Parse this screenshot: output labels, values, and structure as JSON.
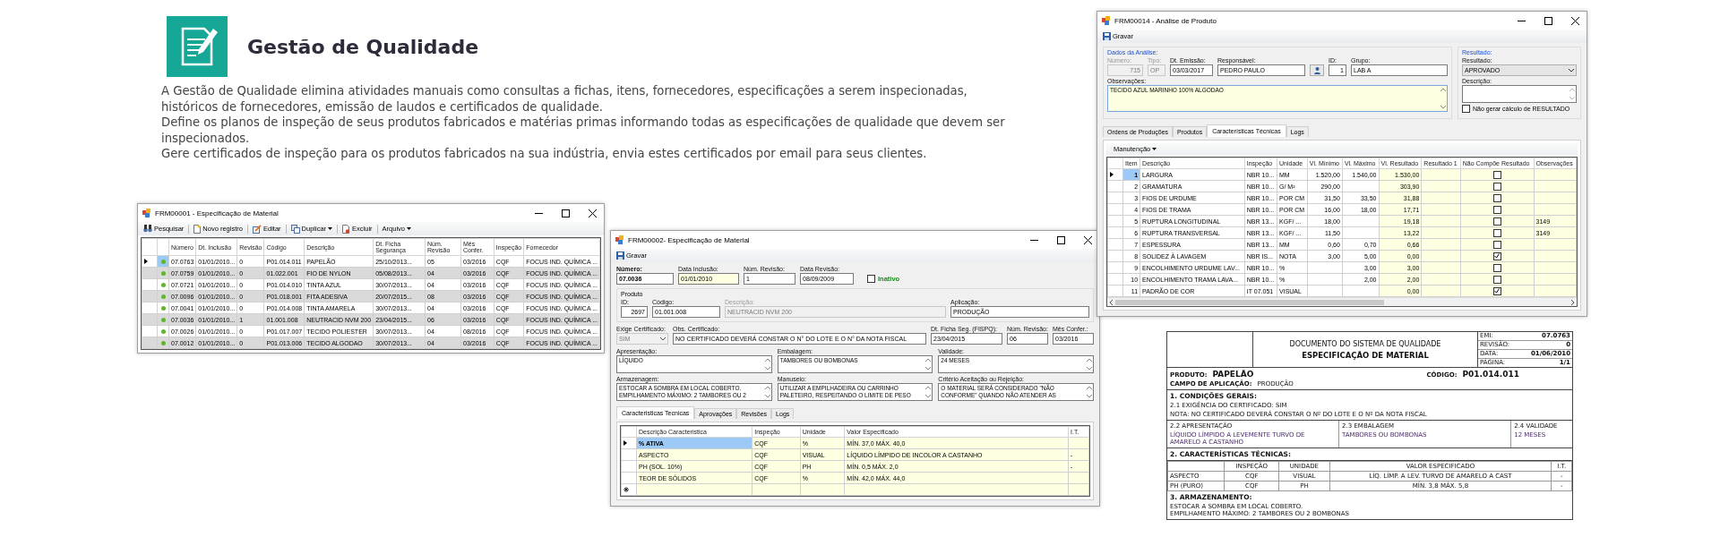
{
  "header": {
    "title": "Gestão de Qualidade",
    "paragraphs": [
      "A Gestão de Qualidade elimina atividades manuais como consultas a fichas, itens, fornecedores, especificações a serem inspecionadas, históricos de fornecedores, emissão de laudos e certificados de qualidade.",
      "Define os planos de inspeção de seus produtos fabricados e matérias primas informando todas as especificações de qualidade que devem ser inspecionados.",
      "Gere certificados de inspeção para os produtos fabricados na sua indústria, envia estes certificados por email para seus clientes."
    ]
  },
  "list_window": {
    "title": "FRM00001 - Especificação de Material",
    "toolbar": {
      "search": "Pesquisar",
      "new": "Novo registro",
      "edit": "Editar",
      "duplicate": "Duplicar",
      "delete": "Excluir",
      "file": "Arquivo"
    },
    "columns": [
      "Número",
      "Dt. Inclusão",
      "Revisão",
      "Código",
      "Descrição",
      "Dt. Ficha Segurança",
      "Núm. Revisão",
      "Mês Confer.",
      "Inspeção",
      "Fornecedor"
    ],
    "rows": [
      {
        "selected": true,
        "cells": [
          "07.0763",
          "01/01/2010...",
          "0",
          "P01.014.011",
          "PAPELÃO",
          "25/10/2013...",
          "05",
          "03/2016",
          "CQF",
          "FOCUS IND. QUÍMICA ..."
        ]
      },
      {
        "selected": false,
        "cells": [
          "07.0759",
          "01/01/2010...",
          "0",
          "01.022.001",
          "FIO DE NYLON",
          "05/08/2013...",
          "04",
          "03/2016",
          "CQF",
          "FOCUS IND. QUÍMICA ..."
        ]
      },
      {
        "selected": false,
        "cells": [
          "07.0721",
          "01/01/2010...",
          "0",
          "P01.014.010",
          "TINTA AZUL",
          "30/07/2013...",
          "04",
          "03/2016",
          "CQF",
          "FOCUS IND. QUÍMICA ..."
        ]
      },
      {
        "selected": false,
        "cells": [
          "07.0096",
          "01/01/2010...",
          "0",
          "P01.018.001",
          "FITA ADESIVA",
          "20/07/2015...",
          "08",
          "03/2016",
          "CQF",
          "FOCUS IND. QUÍMICA ..."
        ]
      },
      {
        "selected": false,
        "cells": [
          "07.0041",
          "01/01/2010...",
          "0",
          "P01.014.008",
          "TINTA AMARELA",
          "30/07/2013...",
          "04",
          "03/2016",
          "CQF",
          "FOCUS IND. QUÍMICA ..."
        ]
      },
      {
        "selected": false,
        "cells": [
          "07.0036",
          "01/01/2010...",
          "1",
          "01.001.008",
          "NEUTRACID NVM 200",
          "23/04/2015...",
          "06",
          "03/2016",
          "CQF",
          "FOCUS IND. QUÍMICA ..."
        ]
      },
      {
        "selected": false,
        "cells": [
          "07.0026",
          "01/01/2010...",
          "0",
          "P01.017.007",
          "TECIDO POLIESTER",
          "30/07/2013...",
          "04",
          "08/2016",
          "CQF",
          "FOCUS IND. QUÍMICA ..."
        ]
      },
      {
        "selected": false,
        "cells": [
          "07.0012",
          "01/01/2010...",
          "0",
          "P01.013.006",
          "TECIDO ALGODAO",
          "30/07/2013...",
          "04",
          "03/2016",
          "CQF",
          "FOCUS IND. QUÍMICA ..."
        ]
      }
    ]
  },
  "form_window": {
    "title": "FRM00002- Especificação de Material",
    "save": "Gravar",
    "numero": {
      "label": "Número:",
      "value": "07.0036"
    },
    "data_inclusao": {
      "label": "Data Inclusão:",
      "value": "01/01/2010"
    },
    "num_revisao": {
      "label": "Núm. Revisão:",
      "value": "1"
    },
    "data_revisao": {
      "label": "Data Revisão:",
      "value": "08/09/2009"
    },
    "inativo": {
      "label": "Inativo",
      "checked": false
    },
    "produto": {
      "label": "Produto",
      "id": {
        "label": "ID:",
        "value": "2697"
      },
      "codigo": {
        "label": "Código:",
        "value": "01.001.008"
      },
      "descricao": {
        "label": "Descrição:",
        "value": "NEUTRACID NVM 200",
        "disabled": true
      },
      "aplicacao": {
        "label": "Aplicação:",
        "value": "PRODUÇÃO"
      }
    },
    "exige_certificado": {
      "label": "Exige Certificado:",
      "value": "SIM",
      "disabled": true
    },
    "obs_certificado": {
      "label": "Obs. Certificado:",
      "value": "NO CERTIFICADO DEVERÁ CONSTAR O N° DO LOTE E O N° DA NOTA FISCAL"
    },
    "dt_ficha": {
      "label": "Dt. Ficha Seg. (FISPQ):",
      "value": "23/04/2015"
    },
    "num_revisao_ficha": {
      "label": "Núm. Revisão:",
      "value": "06"
    },
    "mes_confer": {
      "label": "Mês Confer.:",
      "value": "03/2016"
    },
    "memos": [
      {
        "label": "Apresentação:",
        "value": "LÍQUIDO"
      },
      {
        "label": "Embalagem:",
        "value": "TAMBORES OU BOMBONAS"
      },
      {
        "label": "Validade:",
        "value": "24 MESES"
      },
      {
        "label": "Armazenagem:",
        "value": "ESTOCAR A SOMBRA EM LOCAL COBERTO.\nEMPILHAMENTO MÁXIMO: 2 TAMBORES OU 2"
      },
      {
        "label": "Manuseio:",
        "value": "UTILIZAR A EMPILHADEIRA OU CARRINHO\nPALETEIRO, RESPEITANDO O LIMITE DE PESO"
      },
      {
        "label": "Critério Aceitação ou Rejeição:",
        "value": "O MATERIAL SERÁ CONSIDERADO \"NÃO\nCONFORME\" QUANDO NÃO ATENDER AS"
      }
    ],
    "tabs": [
      {
        "label": "Caracteristicas Tecnicas",
        "selected": true
      },
      {
        "label": "Aprovações",
        "selected": false
      },
      {
        "label": "Revisões",
        "selected": false
      },
      {
        "label": "Logs",
        "selected": false
      }
    ],
    "grid": {
      "columns": [
        "Descrição Caracteristica",
        "Inspeção",
        "Unidade",
        "Valor Especificado",
        "I.T."
      ],
      "rows": [
        {
          "selected": true,
          "cells": [
            "% ATIVA",
            "CQF",
            "%",
            "MÍN. 37,0 MÁX. 40,0"
          ]
        },
        {
          "selected": false,
          "cells": [
            "ASPECTO",
            "CQF",
            "VISUAL",
            "LÍQUIDO LÍMPIDO DE INCOLOR A CASTANHO",
            "-"
          ]
        },
        {
          "selected": false,
          "cells": [
            "PH (SOL. 10%)",
            "CQF",
            "PH",
            "MÍN. 0,5 MÁX. 2,0",
            "-"
          ]
        },
        {
          "selected": false,
          "cells": [
            "TEOR DE SÓLIDOS",
            "CQF",
            "%",
            "MÍN. 42,0 MÁX. 44,0"
          ]
        }
      ]
    }
  },
  "analysis_window": {
    "title": "FRM00014 - Análise de Produto",
    "save": "Gravar",
    "data_group": "Dados da Análise:",
    "numero": {
      "label": "Número:",
      "value": "715",
      "disabled": true
    },
    "tipo": {
      "label": "Tipo:",
      "value": "OP",
      "disabled": true
    },
    "dt_emissao": {
      "label": "Dt. Emissão:",
      "value": "03/03/2017"
    },
    "responsavel": {
      "label": "Responsável:",
      "value": "PEDRO PAULO"
    },
    "id": {
      "label": "ID:",
      "value": "1"
    },
    "grupo": {
      "label": "Grupo:",
      "value": "LAB A"
    },
    "observacoes": {
      "label": "Observações:",
      "value": "TECIDO AZUL MARINHO 100% ALGODAO"
    },
    "result_group": "Resultado:",
    "resultado": {
      "label": "Resultado:",
      "value": "APROVADO"
    },
    "descricao": {
      "label": "Descrição:"
    },
    "no_calc": {
      "label": "Não gerar cálculo de RESULTADO",
      "checked": false
    },
    "tabs": [
      {
        "label": "Ordens de Produções",
        "selected": false
      },
      {
        "label": "Produtos",
        "selected": false
      },
      {
        "label": "Características Técnicas",
        "selected": true
      },
      {
        "label": "Logs",
        "selected": false
      }
    ],
    "menu": "Manutenção",
    "columns": [
      "Item",
      "Descrição",
      "Inspeção",
      "Unidade",
      "Vl. Mínimo",
      "Vl. Máximo",
      "Vl. Resultado",
      "Resultado 1",
      "Não Compõe Resultado",
      "Observações"
    ],
    "rows": [
      {
        "selected": true,
        "item": "1",
        "descricao": "LARGURA",
        "inspecao": "NBR 10...",
        "unidade": "MM",
        "minimo": "1.520,00",
        "maximo": "1.540,00",
        "resultado": "1.530,00",
        "nao_compoe": false
      },
      {
        "selected": false,
        "item": "2",
        "descricao": "GRAMATURA",
        "inspecao": "NBR 10...",
        "unidade": "G/ M²",
        "minimo": "290,00",
        "resultado": "303,90",
        "nao_compoe": false
      },
      {
        "selected": false,
        "item": "3",
        "descricao": "FIOS DE URDUME",
        "inspecao": "NBR 10...",
        "unidade": "POR CM",
        "minimo": "31,50",
        "maximo": "33,50",
        "resultado": "31,88",
        "nao_compoe": false
      },
      {
        "selected": false,
        "item": "4",
        "descricao": "FIOS DE TRAMA",
        "inspecao": "NBR 10...",
        "unidade": "POR CM",
        "minimo": "16,00",
        "maximo": "18,00",
        "resultado": "17,71",
        "nao_compoe": false
      },
      {
        "selected": false,
        "item": "5",
        "descricao": "RUPTURA LONGITUDINAL",
        "inspecao": "NBR 13...",
        "unidade": "KGF/ ...",
        "minimo": "18,00",
        "resultado": "19,18",
        "nao_compoe": false,
        "observacoes": "3149"
      },
      {
        "selected": false,
        "item": "6",
        "descricao": "RUPTURA TRANSVERSAL",
        "inspecao": "NBR 13...",
        "unidade": "KGF/ ...",
        "minimo": "11,50",
        "resultado": "13,22",
        "nao_compoe": false,
        "observacoes": "3149"
      },
      {
        "selected": false,
        "item": "7",
        "descricao": "ESPESSURA",
        "inspecao": "NBR 13...",
        "unidade": "MM",
        "minimo": "0,60",
        "maximo": "0,70",
        "resultado": "0,66",
        "nao_compoe": false
      },
      {
        "selected": false,
        "item": "8",
        "descricao": "SOLIDEZ À LAVAGEM",
        "inspecao": "NBR IS...",
        "unidade": "NOTA",
        "minimo": "3,00",
        "maximo": "5,00",
        "resultado": "0,00",
        "nao_compoe": true
      },
      {
        "selected": false,
        "item": "9",
        "descricao": "ENCOLHIMENTO URDUME LAV...",
        "inspecao": "NBR 10...",
        "unidade": "%",
        "maximo": "3,00",
        "resultado": "3,00",
        "nao_compoe": false
      },
      {
        "selected": false,
        "item": "10",
        "descricao": "ENCOLHIMENTO TRAMA LAVA...",
        "inspecao": "NBR 10...",
        "unidade": "%",
        "maximo": "2,00",
        "resultado": "2,00",
        "nao_compoe": false
      },
      {
        "selected": false,
        "item": "11",
        "descricao": "PADRÃO DE COR",
        "inspecao": "IT 07.051",
        "unidade": "VISUAL",
        "resultado": "0,00",
        "nao_compoe": true
      }
    ]
  },
  "report": {
    "title": "DOCUMENTO DO SISTEMA DE QUALIDADE",
    "subtitle": "ESPECIFICAÇÃO DE MATERIAL",
    "meta": [
      {
        "label": "EMI:",
        "value": "07.0763"
      },
      {
        "label": "REVISÃO:",
        "value": "0"
      },
      {
        "label": "DATA:",
        "value": "01/06/2010"
      },
      {
        "label": "PÁGINA:",
        "value": "1/1"
      }
    ],
    "product_label": "PRODUTO:",
    "product": "PAPELÃO",
    "code_label": "CÓDIGO:",
    "code": "P01.014.011",
    "application_label": "CAMPO DE APLICAÇÃO:",
    "application": "PRODUÇÃO",
    "general_heading": "1. CONDIÇÕES GERAIS:",
    "certificate": "2.1 EXIGÊNCIA DO CERTIFICADO:   SIM",
    "note": "NOTA:   NO CERTIFICADO DEVERÁ CONSTAR O Nº DO LOTE E O Nº DA NOTA FISCAL",
    "conditions": [
      {
        "heading": "2.2 APRESENTAÇÃO",
        "text": "LÍQUIDO LÍMPIDO A LEVEMENTE TURVO DE AMARELO A CASTANHO"
      },
      {
        "heading": "2.3 EMBALAGEM",
        "text": "TAMBORES OU BOMBONAS"
      },
      {
        "heading": "2.4 VALIDADE",
        "text": "12 MESES"
      }
    ],
    "tech_heading": "2. CARACTERÍSTICAS TÉCNICAS:",
    "tech_columns": [
      "INSPEÇÃO",
      "UNIDADE",
      "VALOR ESPECIFICADO",
      "I.T."
    ],
    "tech_rows": [
      [
        "ASPECTO",
        "CQF",
        "VISUAL",
        "LÍQ. LÍMP. A LEV. TURVO DE AMARELO A CAST",
        "-"
      ],
      [
        "PH (PURO)",
        "CQF",
        "PH",
        "MÍN. 3,8 MÁX. 5,8",
        "-"
      ]
    ],
    "storage_heading": "3. ARMAZENAMENTO:",
    "storage": "ESTOCAR A SOMBRA EM LOCAL COBERTO.\nEMPILHAMENTO MÁXIMO: 2 TAMBORES OU 2 BOMBONAS"
  }
}
